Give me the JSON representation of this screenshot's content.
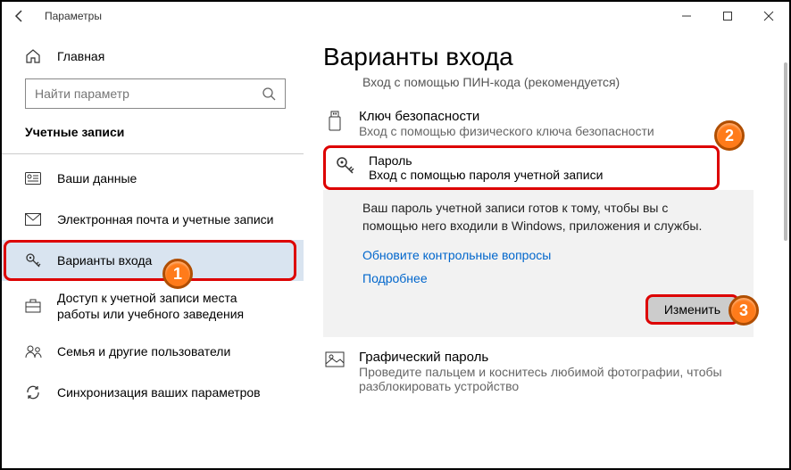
{
  "window": {
    "title": "Параметры"
  },
  "sidebar": {
    "home": "Главная",
    "search_placeholder": "Найти параметр",
    "section": "Учетные записи",
    "items": [
      {
        "label": "Ваши данные"
      },
      {
        "label": "Электронная почта и учетные записи"
      },
      {
        "label": "Варианты входа"
      },
      {
        "label": "Доступ к учетной записи места работы или учебного заведения"
      },
      {
        "label": "Семья и другие пользователи"
      },
      {
        "label": "Синхронизация ваших параметров"
      }
    ]
  },
  "main": {
    "title": "Варианты входа",
    "truncated_prev": "Вход с помощью ПИН-кода (рекомендуется)",
    "security_key": {
      "title": "Ключ безопасности",
      "sub": "Вход с помощью физического ключа безопасности"
    },
    "password": {
      "title": "Пароль",
      "sub": "Вход с помощью пароля учетной записи",
      "desc": "Ваш пароль учетной записи готов к тому, чтобы вы с помощью него входили в Windows, приложения и службы.",
      "link_questions": "Обновите контрольные вопросы",
      "link_more": "Подробнее",
      "change_btn": "Изменить"
    },
    "picture_password": {
      "title": "Графический пароль",
      "sub": "Проведите пальцем и коснитесь любимой фотографии, чтобы разблокировать устройство"
    }
  },
  "badges": {
    "b1": "1",
    "b2": "2",
    "b3": "3"
  }
}
